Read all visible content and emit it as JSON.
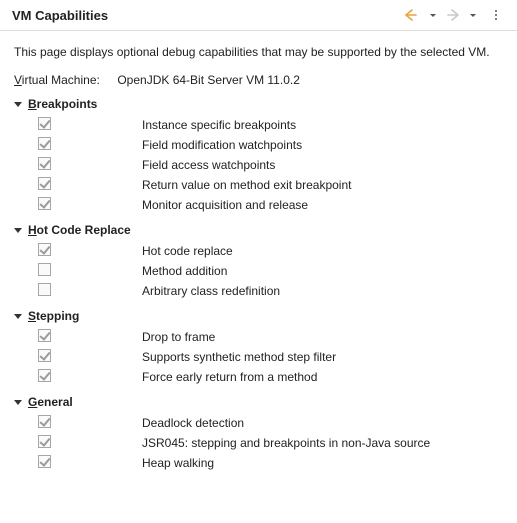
{
  "title": "VM Capabilities",
  "description": "This page displays optional debug capabilities that may be supported by the selected VM.",
  "vm": {
    "label_prefix": "V",
    "label_rest": "irtual Machine:",
    "value": "OpenJDK 64-Bit Server VM 11.0.2"
  },
  "sections": {
    "breakpoints": {
      "mnemonic": "B",
      "rest": "reakpoints",
      "items": [
        {
          "label": "Instance specific breakpoints",
          "checked": true
        },
        {
          "label": "Field modification watchpoints",
          "checked": true
        },
        {
          "label": "Field access watchpoints",
          "checked": true
        },
        {
          "label": "Return value on method exit breakpoint",
          "checked": true
        },
        {
          "label": "Monitor acquisition and release",
          "checked": true
        }
      ]
    },
    "hotcode": {
      "mnemonic": "H",
      "rest": "ot Code Replace",
      "items": [
        {
          "label": "Hot code replace",
          "checked": true
        },
        {
          "label": "Method addition",
          "checked": false
        },
        {
          "label": "Arbitrary class redefinition",
          "checked": false
        }
      ]
    },
    "stepping": {
      "mnemonic": "S",
      "rest": "tepping",
      "items": [
        {
          "label": "Drop to frame",
          "checked": true
        },
        {
          "label": "Supports synthetic method step filter",
          "checked": true
        },
        {
          "label": "Force early return from a method",
          "checked": true
        }
      ]
    },
    "general": {
      "mnemonic": "G",
      "rest": "eneral",
      "items": [
        {
          "label": "Deadlock detection",
          "checked": true
        },
        {
          "label": "JSR045: stepping and breakpoints in non-Java source",
          "checked": true
        },
        {
          "label": "Heap walking",
          "checked": true
        }
      ]
    }
  }
}
